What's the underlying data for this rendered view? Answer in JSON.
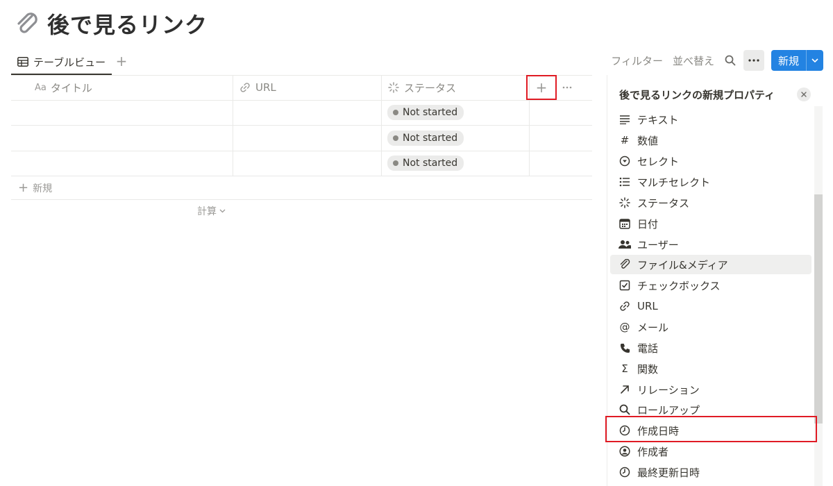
{
  "page": {
    "icon": "paperclip-icon",
    "title": "後で見るリンク"
  },
  "viewbar": {
    "tab_label": "テーブルビュー",
    "add_view": "+",
    "filter_label": "フィルター",
    "sort_label": "並べ替え",
    "new_label": "新規"
  },
  "table": {
    "columns": [
      {
        "prefix": "Aa",
        "label": "タイトル"
      },
      {
        "icon": "link-icon",
        "label": "URL"
      },
      {
        "icon": "status-icon",
        "label": "ステータス"
      }
    ],
    "add_column": "+",
    "rows": [
      {
        "title": "",
        "url": "",
        "status": "Not started"
      },
      {
        "title": "",
        "url": "",
        "status": "Not started"
      },
      {
        "title": "",
        "url": "",
        "status": "Not started"
      }
    ],
    "new_row_label": "新規",
    "calc_label": "計算"
  },
  "panel": {
    "title": "後で見るリンクの新規プロパティ",
    "types": [
      {
        "icon": "text-icon",
        "label": "テキスト"
      },
      {
        "icon": "number-icon",
        "label": "数値"
      },
      {
        "icon": "select-icon",
        "label": "セレクト"
      },
      {
        "icon": "multiselect-icon",
        "label": "マルチセレクト"
      },
      {
        "icon": "status-icon",
        "label": "ステータス"
      },
      {
        "icon": "calendar-icon",
        "label": "日付"
      },
      {
        "icon": "people-icon",
        "label": "ユーザー"
      },
      {
        "icon": "paperclip-icon",
        "label": "ファイル&メディア"
      },
      {
        "icon": "checkbox-icon",
        "label": "チェックボックス"
      },
      {
        "icon": "link-icon",
        "label": "URL"
      },
      {
        "icon": "at-icon",
        "label": "メール"
      },
      {
        "icon": "phone-icon",
        "label": "電話"
      },
      {
        "icon": "sigma-icon",
        "label": "関数"
      },
      {
        "icon": "arrow-icon",
        "label": "リレーション"
      },
      {
        "icon": "search-icon",
        "label": "ロールアップ"
      },
      {
        "icon": "clock-icon",
        "label": "作成日時"
      },
      {
        "icon": "user-circle-icon",
        "label": "作成者"
      },
      {
        "icon": "clock-icon",
        "label": "最終更新日時"
      }
    ]
  },
  "colors": {
    "accent": "#2383e2",
    "highlight": "#e01b24"
  }
}
